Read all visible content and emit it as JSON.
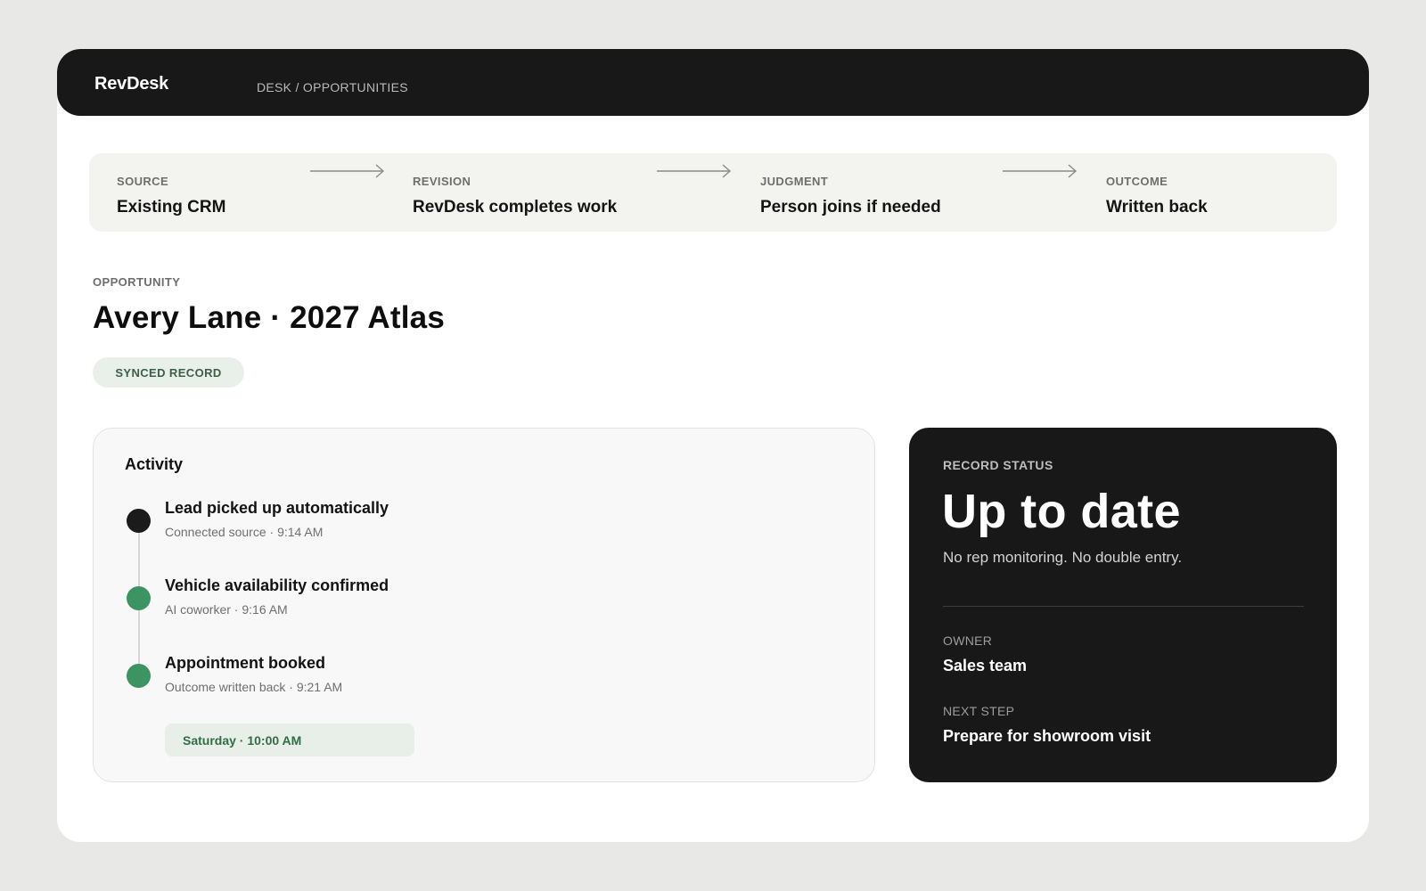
{
  "app": {
    "brand": "RevDesk",
    "breadcrumb": "DESK / OPPORTUNITIES"
  },
  "pipeline": {
    "stages": [
      {
        "label": "SOURCE",
        "value": "Existing CRM"
      },
      {
        "label": "REVISION",
        "value": "RevDesk completes work"
      },
      {
        "label": "JUDGMENT",
        "value": "Person joins if needed"
      },
      {
        "label": "OUTCOME",
        "value": "Written back"
      }
    ],
    "connector_icon": "arrow-right-icon"
  },
  "opportunity": {
    "eyebrow": "OPPORTUNITY",
    "title": "Avery Lane · 2027 Atlas",
    "badge": "SYNCED RECORD"
  },
  "activity": {
    "title": "Activity",
    "items": [
      {
        "title": "Lead picked up automatically",
        "subtitle": "Connected source · 9:14 AM",
        "dot_color": "#1b1b1b"
      },
      {
        "title": "Vehicle availability confirmed",
        "subtitle": "AI coworker · 9:16 AM",
        "dot_color": "#3b9461"
      },
      {
        "title": "Appointment booked",
        "subtitle": "Outcome written back · 9:21 AM",
        "dot_color": "#3b9461"
      }
    ],
    "appointment": "Saturday · 10:00 AM"
  },
  "record_status": {
    "label": "RECORD STATUS",
    "value": "Up to date",
    "note": "No rep monitoring. No double entry.",
    "owner_label": "OWNER",
    "owner_value": "Sales team",
    "next_step_label": "NEXT STEP",
    "next_step_value": "Prepare for showroom visit"
  },
  "colors": {
    "dark": "#181818",
    "accent_green": "#3b9461",
    "background": "#e8e9e6"
  }
}
